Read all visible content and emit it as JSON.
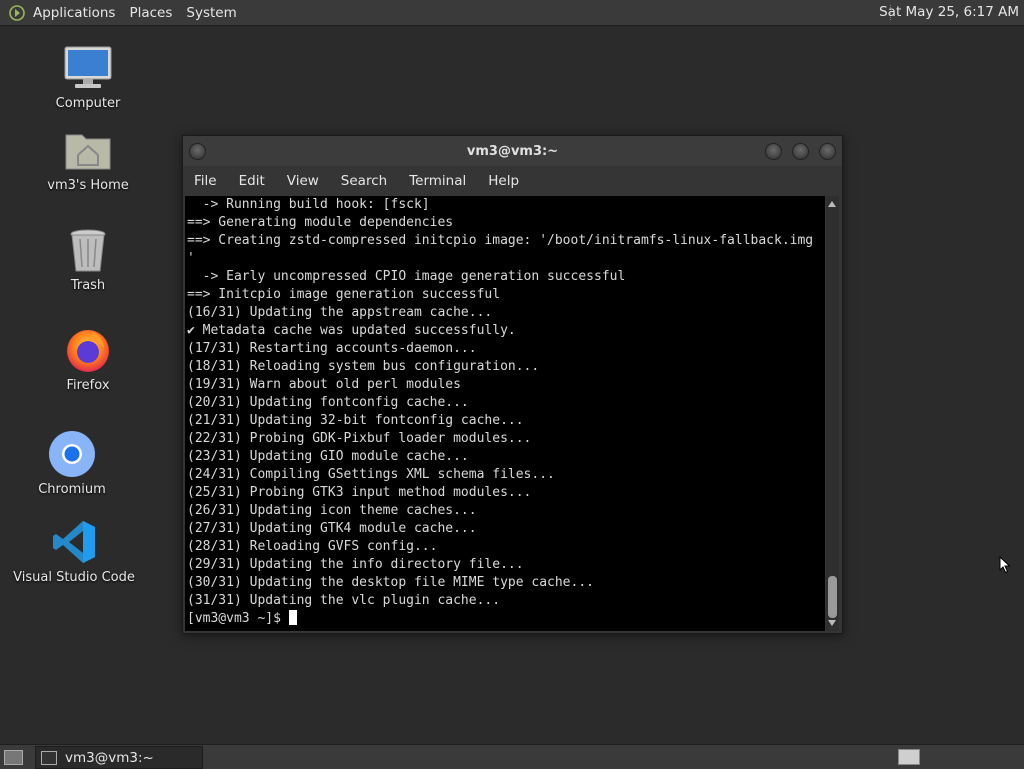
{
  "top_panel": {
    "menus": [
      "Applications",
      "Places",
      "System"
    ],
    "clock": "Sat May 25,  6:17 AM"
  },
  "desktop": {
    "icons": [
      {
        "label": "Computer",
        "icon": "computer-icon"
      },
      {
        "label": "vm3's Home",
        "icon": "home-folder-icon"
      },
      {
        "label": "Trash",
        "icon": "trash-icon"
      },
      {
        "label": "Firefox",
        "icon": "firefox-icon"
      },
      {
        "label": "Chromium",
        "icon": "chromium-icon"
      },
      {
        "label": "Visual Studio Code",
        "icon": "vscode-icon"
      }
    ]
  },
  "window": {
    "title": "vm3@vm3:~",
    "menu": [
      "File",
      "Edit",
      "View",
      "Search",
      "Terminal",
      "Help"
    ],
    "lines": [
      "  -> Running build hook: [fsck]",
      "==> Generating module dependencies",
      "==> Creating zstd-compressed initcpio image: '/boot/initramfs-linux-fallback.img",
      "'",
      "  -> Early uncompressed CPIO image generation successful",
      "==> Initcpio image generation successful",
      "(16/31) Updating the appstream cache...",
      "✔ Metadata cache was updated successfully.",
      "(17/31) Restarting accounts-daemon...",
      "(18/31) Reloading system bus configuration...",
      "(19/31) Warn about old perl modules",
      "(20/31) Updating fontconfig cache...",
      "(21/31) Updating 32-bit fontconfig cache...",
      "(22/31) Probing GDK-Pixbuf loader modules...",
      "(23/31) Updating GIO module cache...",
      "(24/31) Compiling GSettings XML schema files...",
      "(25/31) Probing GTK3 input method modules...",
      "(26/31) Updating icon theme caches...",
      "(27/31) Updating GTK4 module cache...",
      "(28/31) Reloading GVFS config...",
      "(29/31) Updating the info directory file...",
      "(30/31) Updating the desktop file MIME type cache...",
      "(31/31) Updating the vlc plugin cache..."
    ],
    "prompt": "[vm3@vm3 ~]$ "
  },
  "bottom_panel": {
    "task_label": "vm3@vm3:~"
  },
  "colors": {
    "desktop_bg": "#2b2b2b",
    "panel_bg": "#3a3a3a",
    "terminal_bg": "#000000",
    "terminal_fg": "#d9d9d9"
  }
}
